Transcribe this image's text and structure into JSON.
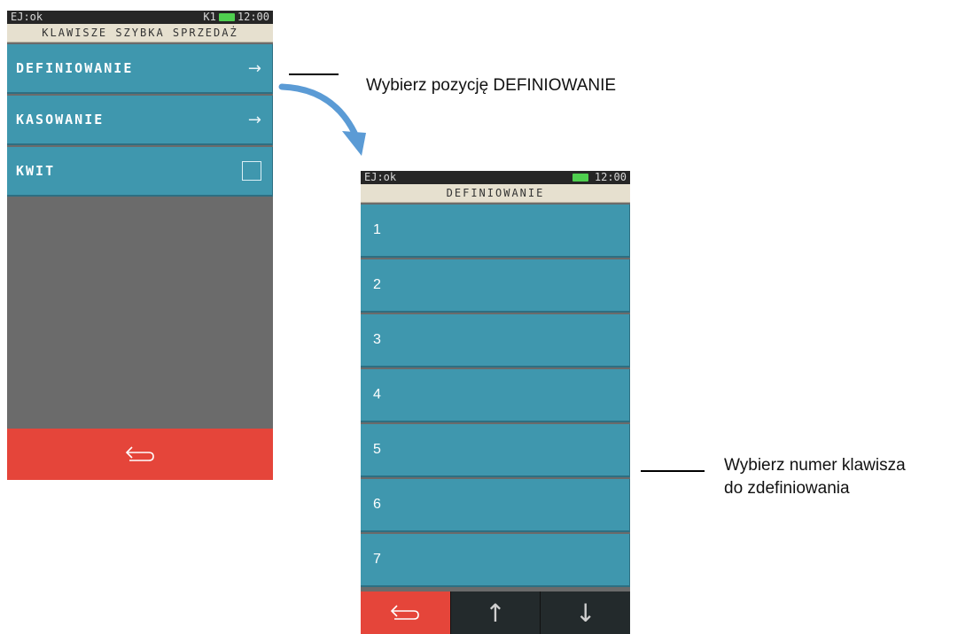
{
  "screen1": {
    "status_left": "EJ:ok",
    "status_right": "K1",
    "time": "12:00",
    "title": "KLAWISZE SZYBKA SPRZEDAŻ",
    "items": [
      {
        "label": "DEFINIOWANIE",
        "icon": "arrow-right-icon",
        "glyph": "→"
      },
      {
        "label": "KASOWANIE",
        "icon": "arrow-right-icon",
        "glyph": "→"
      },
      {
        "label": "KWIT",
        "icon": "checkbox-icon"
      }
    ],
    "back_icon": "back-arrow-icon"
  },
  "screen2": {
    "status_left": "EJ:ok",
    "time": "12:00",
    "title": "DEFINIOWANIE",
    "items": [
      "1",
      "2",
      "3",
      "4",
      "5",
      "6",
      "7"
    ],
    "bottom": {
      "back_icon": "back-arrow-icon",
      "up_icon": "arrow-up-icon",
      "down_icon": "arrow-down-icon",
      "up_glyph": "↑",
      "down_glyph": "↓"
    }
  },
  "callouts": {
    "first": "Wybierz pozycję DEFINIOWANIE",
    "second_line1": "Wybierz numer klawisza",
    "second_line2": "do zdefiniowania"
  },
  "colors": {
    "teal": "#3f97ae",
    "red": "#e5453a",
    "arrow_blue": "#5b9bd5",
    "status_bg": "#262626",
    "title_bg": "#e6e0cf"
  }
}
